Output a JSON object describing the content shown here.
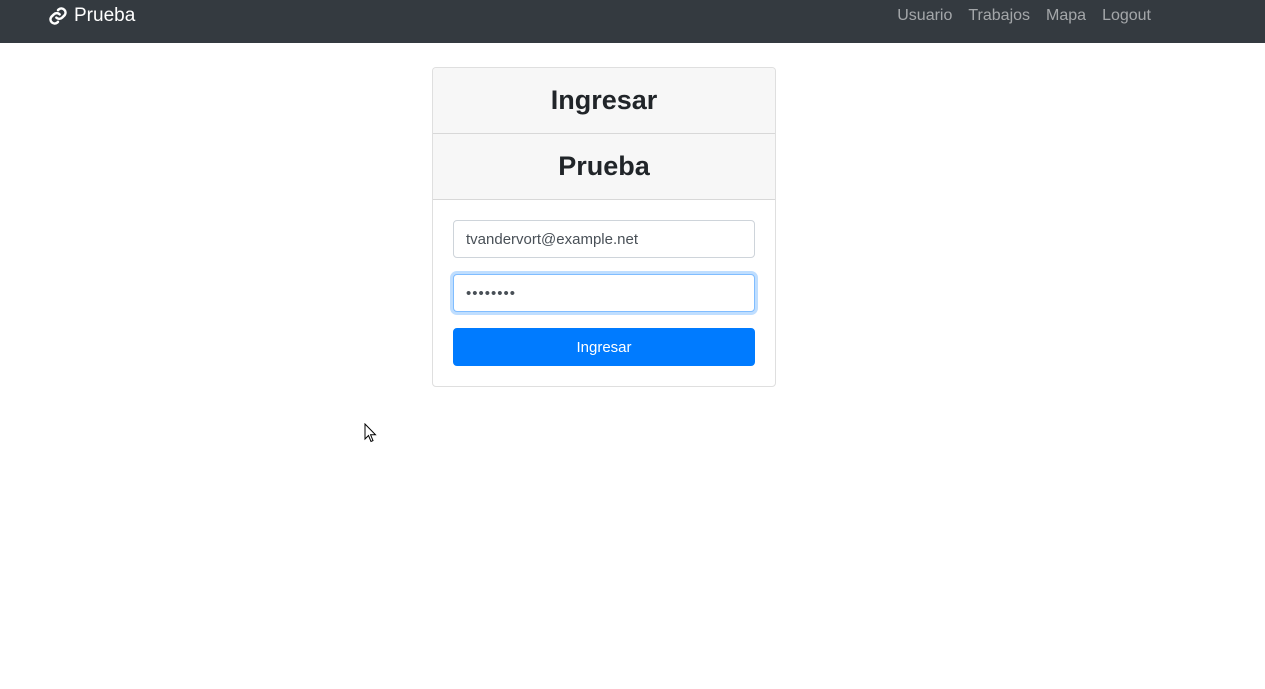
{
  "navbar": {
    "brand_icon": "link-icon",
    "brand_label": "Prueba",
    "links": [
      {
        "label": "Usuario"
      },
      {
        "label": "Trabajos"
      },
      {
        "label": "Mapa"
      },
      {
        "label": "Logout"
      }
    ]
  },
  "card": {
    "header_title": "Ingresar",
    "header_subtitle": "Prueba",
    "email_value": "tvandervort@example.net",
    "password_value": "12345678",
    "submit_label": "Ingresar"
  },
  "colors": {
    "navbar_bg": "#343a40",
    "primary": "#007bff"
  }
}
